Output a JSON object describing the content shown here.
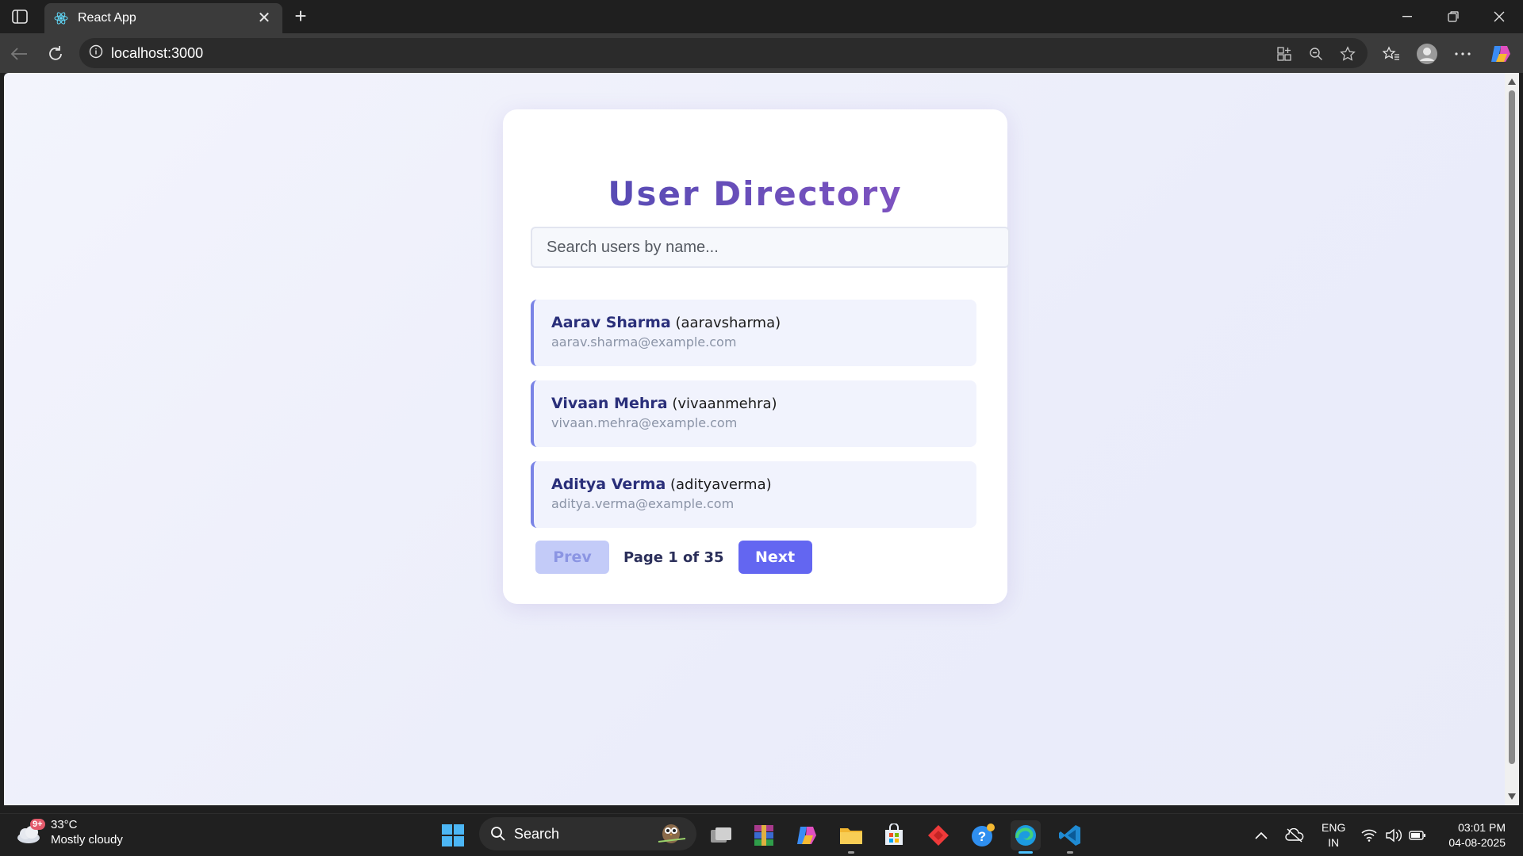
{
  "browser": {
    "tab_title": "React App",
    "url": "localhost:3000"
  },
  "app": {
    "title": "User Directory",
    "search_placeholder": "Search users by name...",
    "users": [
      {
        "name": "Aarav Sharma",
        "username": "(aaravsharma)",
        "email": "aarav.sharma@example.com"
      },
      {
        "name": "Vivaan Mehra",
        "username": "(vivaanmehra)",
        "email": "vivaan.mehra@example.com"
      },
      {
        "name": "Aditya Verma",
        "username": "(adityaverma)",
        "email": "aditya.verma@example.com"
      }
    ],
    "pagination": {
      "prev_label": "Prev",
      "next_label": "Next",
      "page_info": "Page 1 of 35"
    }
  },
  "taskbar": {
    "weather": {
      "temp": "33°C",
      "condition": "Mostly cloudy",
      "badge": "9+"
    },
    "search_label": "Search",
    "language": {
      "line1": "ENG",
      "line2": "IN"
    },
    "clock": {
      "time": "03:01 PM",
      "date": "04-08-2025"
    }
  },
  "colors": {
    "accent": "#6366f1",
    "title_gradient_start": "#4a48b0",
    "title_gradient_end": "#8a55c4",
    "card_border": "#7a84e6"
  },
  "icons": [
    "react-favicon-icon",
    "info-icon",
    "refresh-icon",
    "back-icon",
    "star-icon",
    "zoom-icon",
    "profile-icon",
    "windows-start-icon",
    "edge-icon",
    "vscode-icon"
  ]
}
